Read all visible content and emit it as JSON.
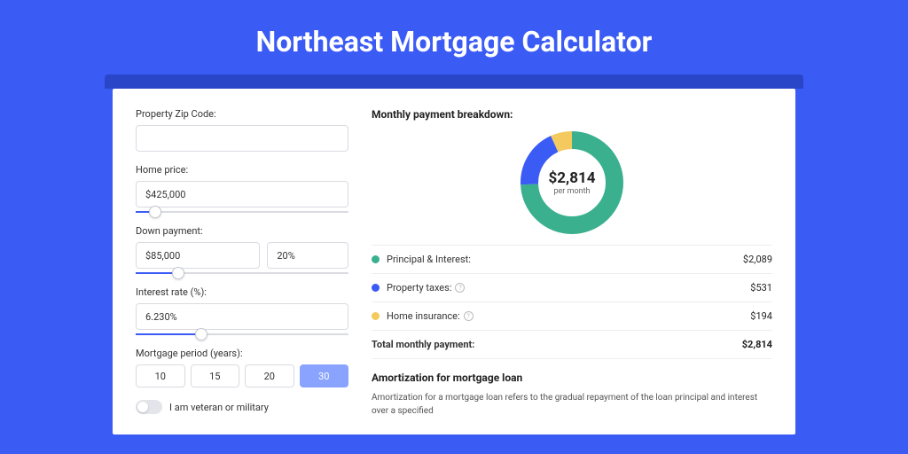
{
  "title": "Northeast Mortgage Calculator",
  "form": {
    "zip_label": "Property Zip Code:",
    "zip_value": "",
    "price_label": "Home price:",
    "price_value": "$425,000",
    "price_slider_pct": 9,
    "down_label": "Down payment:",
    "down_value": "$85,000",
    "down_pct_value": "20%",
    "down_slider_pct": 20,
    "rate_label": "Interest rate (%):",
    "rate_value": "6.230%",
    "rate_slider_pct": 31,
    "period_label": "Mortgage period (years):",
    "periods": [
      "10",
      "15",
      "20",
      "30"
    ],
    "period_active_index": 3,
    "veteran_label": "I am veteran or military",
    "veteran_on": false
  },
  "breakdown": {
    "title": "Monthly payment breakdown:",
    "center_value": "$2,814",
    "center_sub": "per month",
    "items": [
      {
        "label": "Principal & Interest:",
        "value": "$2,089",
        "color": "#3ab08f",
        "info": false,
        "amount": 2089
      },
      {
        "label": "Property taxes:",
        "value": "$531",
        "color": "#3b5bf5",
        "info": true,
        "amount": 531
      },
      {
        "label": "Home insurance:",
        "value": "$194",
        "color": "#f4c95d",
        "info": true,
        "amount": 194
      }
    ],
    "total_label": "Total monthly payment:",
    "total_value": "$2,814"
  },
  "amortization": {
    "title": "Amortization for mortgage loan",
    "text": "Amortization for a mortgage loan refers to the gradual repayment of the loan principal and interest over a specified"
  },
  "chart_data": {
    "type": "pie",
    "title": "Monthly payment breakdown",
    "categories": [
      "Principal & Interest",
      "Property taxes",
      "Home insurance"
    ],
    "values": [
      2089,
      531,
      194
    ],
    "colors": [
      "#3ab08f",
      "#3b5bf5",
      "#f4c95d"
    ],
    "center_label": "$2,814 per month"
  }
}
